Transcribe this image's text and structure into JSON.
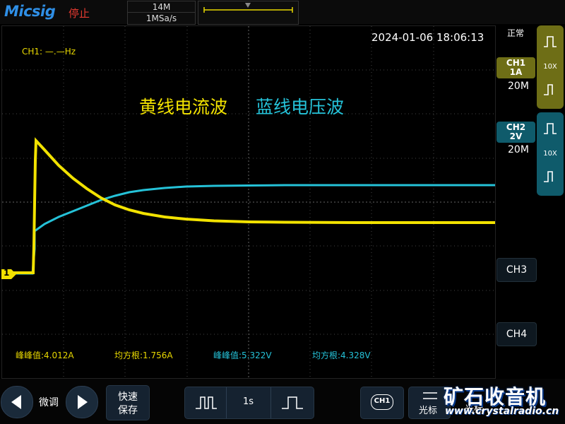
{
  "header": {
    "logo": "Micsig",
    "run_state": "停止",
    "memory_depth": "14M",
    "sample_rate": "1MSa/s"
  },
  "screen": {
    "timestamp": "2024-01-06 18:06:13",
    "ch1_frequency": "CH1: —.—Hz",
    "title_yellow": "黄线电流波",
    "title_cyan": "蓝线电压波",
    "ground_marker": "1",
    "measurements": [
      {
        "label": "峰峰值:4.012A",
        "color": "#e8d800"
      },
      {
        "label": "均方根:1.756A",
        "color": "#e8d800"
      },
      {
        "label": "峰峰值:5.322V",
        "color": "#25c2d8"
      },
      {
        "label": "均方根:4.328V",
        "color": "#25c2d8"
      }
    ]
  },
  "right_panel": {
    "mode": "正常",
    "ch1": {
      "name": "CH1",
      "scale": "1A",
      "bandwidth": "20M",
      "probe": "10X",
      "color": "#6e6e16"
    },
    "ch2": {
      "name": "CH2",
      "scale": "2V",
      "bandwidth": "20M",
      "probe": "10X",
      "color": "#0f5b6b"
    },
    "ch3_label": "CH3",
    "ch4_label": "CH4"
  },
  "bottom": {
    "fine_label": "微调",
    "save_line1": "快速",
    "save_line2": "保存",
    "timebase": "1s",
    "ch1_chip": "CH1",
    "cursor_label": "光标",
    "cursor_label2": "光标"
  },
  "watermark": {
    "text": "矿石收音机",
    "url": "www.crystalradio.cn"
  },
  "colors": {
    "ch1": "#f2e200",
    "ch2": "#25c2d8",
    "accent": "#2f8fe6"
  }
}
